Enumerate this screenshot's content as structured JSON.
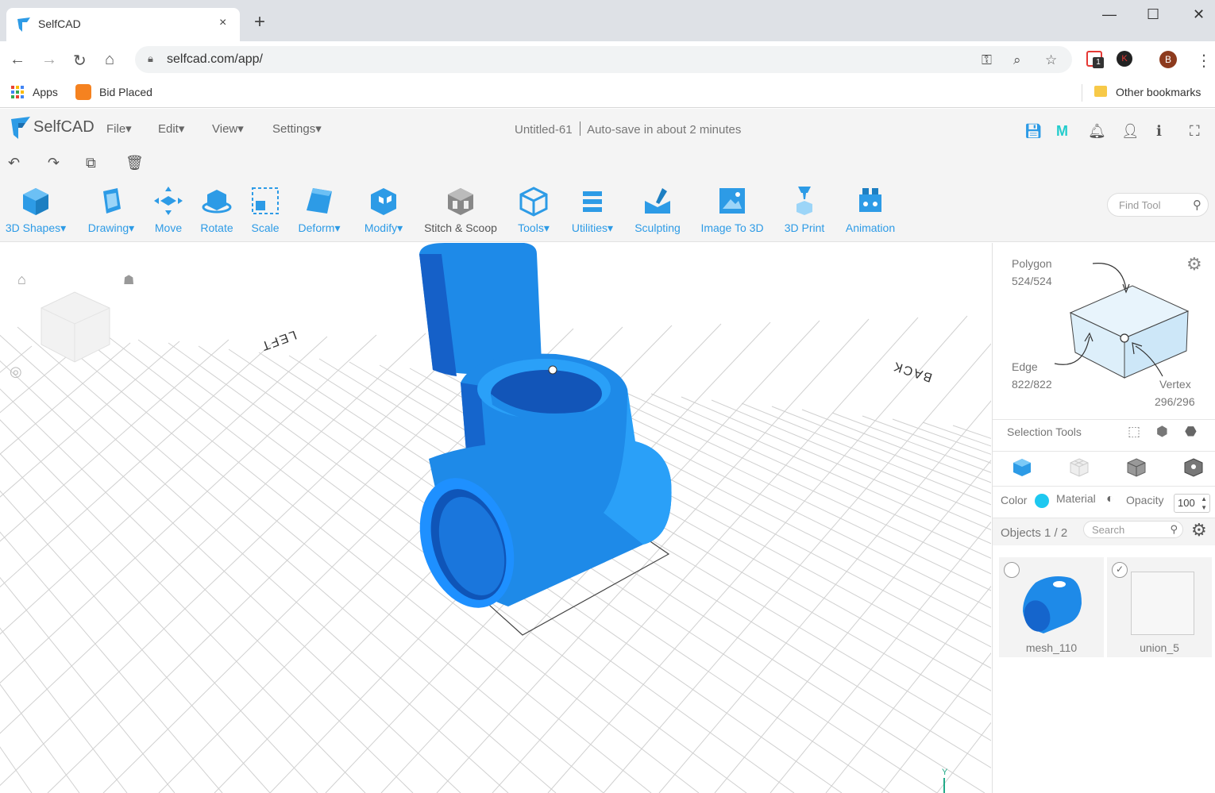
{
  "browser": {
    "tab_title": "SelfCAD",
    "tab_close": "×",
    "new_tab": "+",
    "url": "selfcad.com/app/",
    "bookmarks": [
      {
        "label": "Apps"
      },
      {
        "label": "Bid Placed"
      }
    ],
    "other_bookmarks": "Other bookmarks",
    "profile_initial": "B",
    "ext_badge": "1",
    "ext_k": "K"
  },
  "app": {
    "logo_text": "SelfCAD",
    "menus": [
      "File",
      "Edit",
      "View",
      "Settings"
    ],
    "doc_name": "Untitled-61",
    "autosave": "Auto-save in about 2 minutes",
    "accent": "#2d9be6",
    "model_color": "#1e90ff"
  },
  "toolbar": {
    "tools": [
      {
        "label": "3D Shapes",
        "dropdown": true,
        "icon": "cube-icon"
      },
      {
        "label": "Drawing",
        "dropdown": true,
        "icon": "drawing-icon"
      },
      {
        "label": "Move",
        "dropdown": false,
        "icon": "move-icon"
      },
      {
        "label": "Rotate",
        "dropdown": false,
        "icon": "rotate-icon"
      },
      {
        "label": "Scale",
        "dropdown": false,
        "icon": "scale-icon"
      },
      {
        "label": "Deform",
        "dropdown": true,
        "icon": "deform-icon"
      },
      {
        "label": "Modify",
        "dropdown": true,
        "icon": "modify-icon"
      },
      {
        "label": "Stitch & Scoop",
        "dropdown": false,
        "icon": "stitch-icon"
      },
      {
        "label": "Tools",
        "dropdown": true,
        "icon": "tools-icon"
      },
      {
        "label": "Utilities",
        "dropdown": true,
        "icon": "utilities-icon"
      },
      {
        "label": "Sculpting",
        "dropdown": false,
        "icon": "sculpting-icon"
      },
      {
        "label": "Image To 3D",
        "dropdown": false,
        "icon": "image-icon"
      },
      {
        "label": "3D Print",
        "dropdown": false,
        "icon": "print-icon"
      },
      {
        "label": "Animation",
        "dropdown": false,
        "icon": "animation-icon"
      }
    ],
    "find_tool_placeholder": "Find Tool"
  },
  "viewport": {
    "label_left": "LEFT",
    "label_back": "BACK",
    "axis_y": "Y"
  },
  "panel": {
    "polygon_label": "Polygon",
    "polygon_count": "524/524",
    "edge_label": "Edge",
    "edge_count": "822/822",
    "vertex_label": "Vertex",
    "vertex_count": "296/296",
    "selection_tools": "Selection Tools",
    "color_label": "Color",
    "color_value": "#1ec8f0",
    "material_label": "Material",
    "opacity_label": "Opacity",
    "opacity_value": "100",
    "objects_label": "Objects 1 / 2",
    "search_placeholder": "Search",
    "objects": [
      {
        "name": "mesh_110",
        "selected": false
      },
      {
        "name": "union_5",
        "selected": true,
        "check": "✓"
      }
    ]
  }
}
